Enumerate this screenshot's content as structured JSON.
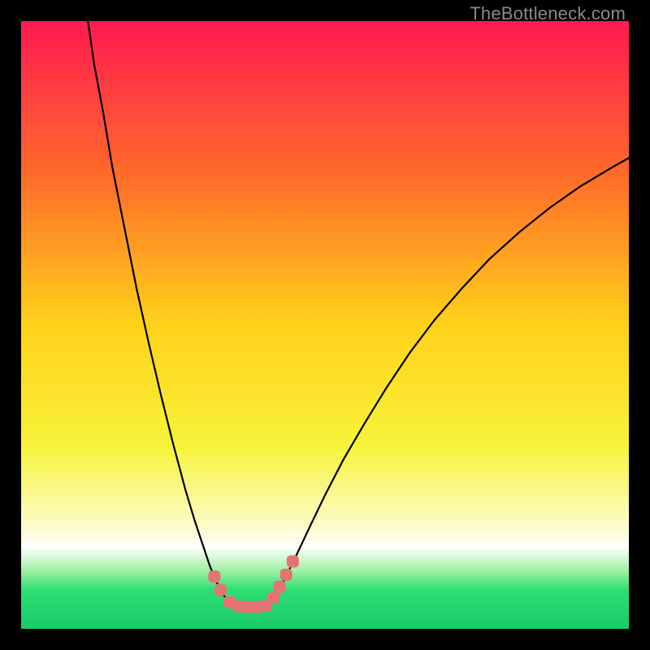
{
  "watermark": "TheBottleneck.com",
  "chart_data": {
    "type": "line",
    "title": "",
    "xlabel": "",
    "ylabel": "",
    "xlim": [
      0,
      100
    ],
    "ylim": [
      0,
      100
    ],
    "grid": false,
    "background_gradient": {
      "stops": [
        {
          "offset": 0.0,
          "color": "#ff1a52"
        },
        {
          "offset": 0.25,
          "color": "#ff6a2a"
        },
        {
          "offset": 0.5,
          "color": "#ffd21a"
        },
        {
          "offset": 0.7,
          "color": "#f7f33a"
        },
        {
          "offset": 0.835,
          "color": "#fbfccf"
        },
        {
          "offset": 0.865,
          "color": "#ffffff"
        },
        {
          "offset": 0.905,
          "color": "#9ef0a0"
        },
        {
          "offset": 0.935,
          "color": "#2fdf74"
        },
        {
          "offset": 1.0,
          "color": "#18c968"
        }
      ]
    },
    "series": [
      {
        "name": "left-curve",
        "color": "#000000",
        "x": [
          11.0,
          12.0,
          13.5,
          15.0,
          17.0,
          19.0,
          21.0,
          23.0,
          25.0,
          27.0,
          28.5,
          30.0,
          31.0,
          32.0,
          33.0,
          34.0,
          34.8
        ],
        "y": [
          100.0,
          93.0,
          85.0,
          76.0,
          66.0,
          56.0,
          47.0,
          38.5,
          30.5,
          23.0,
          18.0,
          13.5,
          10.5,
          8.0,
          6.0,
          4.6,
          3.9
        ]
      },
      {
        "name": "right-curve",
        "color": "#000000",
        "x": [
          40.5,
          41.5,
          43.0,
          45.0,
          47.5,
          50.0,
          53.0,
          56.5,
          60.0,
          64.0,
          68.0,
          72.5,
          77.0,
          82.0,
          87.0,
          92.0,
          97.0,
          100.0
        ],
        "y": [
          3.9,
          5.0,
          7.5,
          11.5,
          16.8,
          22.0,
          27.8,
          33.8,
          39.5,
          45.5,
          50.8,
          56.0,
          60.8,
          65.3,
          69.3,
          72.8,
          75.8,
          77.5
        ]
      },
      {
        "name": "trough-flat",
        "color": "#000000",
        "x": [
          34.8,
          36.0,
          38.0,
          40.0,
          40.5
        ],
        "y": [
          3.9,
          3.7,
          3.6,
          3.7,
          3.9
        ]
      }
    ],
    "markers": {
      "name": "trough-markers",
      "color": "#e57373",
      "shape": "rounded-square",
      "points": [
        {
          "x": 31.8,
          "y": 8.6
        },
        {
          "x": 32.8,
          "y": 6.4
        },
        {
          "x": 34.3,
          "y": 4.4
        },
        {
          "x": 35.8,
          "y": 3.7
        },
        {
          "x": 37.3,
          "y": 3.6
        },
        {
          "x": 38.8,
          "y": 3.6
        },
        {
          "x": 40.3,
          "y": 3.8
        },
        {
          "x": 41.5,
          "y": 5.1
        },
        {
          "x": 42.5,
          "y": 6.9
        },
        {
          "x": 43.6,
          "y": 8.9
        },
        {
          "x": 44.7,
          "y": 11.1
        }
      ]
    }
  }
}
